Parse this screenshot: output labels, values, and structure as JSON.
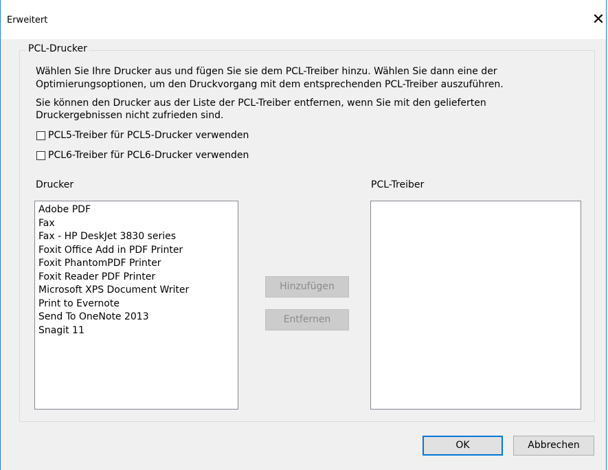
{
  "window": {
    "title": "Erweitert",
    "close_glyph": "✕"
  },
  "group": {
    "label": "PCL-Drucker"
  },
  "description": {
    "line1": "Wählen Sie Ihre Drucker aus und fügen Sie sie dem PCL-Treiber hinzu. Wählen Sie dann eine der",
    "line2": "Optimierungsoptionen, um den Druckvorgang mit dem entsprechenden PCL-Treiber auszuführen.",
    "line3": "Sie können den Drucker aus der Liste der PCL-Treiber entfernen, wenn Sie mit den gelieferten",
    "line4": "Druckergebnissen nicht zufrieden sind."
  },
  "options": {
    "pcl5": {
      "label": "PCL5-Treiber für PCL5-Drucker verwenden",
      "checked": false
    },
    "pcl6": {
      "label": "PCL6-Treiber für PCL6-Drucker verwenden",
      "checked": false
    }
  },
  "printers": {
    "label": "Drucker",
    "items": [
      "Adobe PDF",
      "Fax",
      "Fax - HP DeskJet 3830 series",
      "Foxit Office Add in PDF Printer",
      "Foxit PhantomPDF Printer",
      "Foxit Reader PDF Printer",
      "Microsoft XPS Document Writer",
      "Print to Evernote",
      "Send To OneNote 2013",
      "Snagit 11"
    ]
  },
  "pcl_drivers": {
    "label": "PCL-Treiber",
    "items": []
  },
  "buttons": {
    "add": "Hinzufügen",
    "remove": "Entfernen",
    "ok": "OK",
    "cancel": "Abbrechen"
  }
}
